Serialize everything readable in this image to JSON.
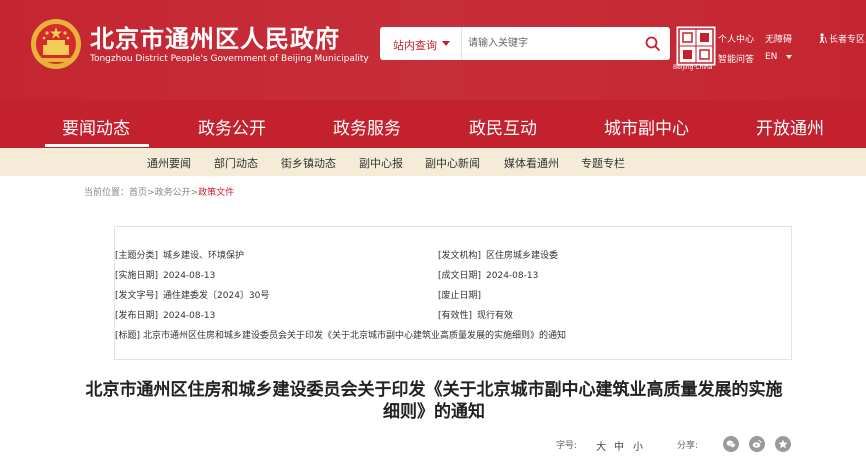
{
  "header": {
    "site_title": "北京市通州区人民政府",
    "site_subtitle": "Tongzhou District People's Government of Beijing Municipality",
    "seal_caption": "Beijing·China",
    "search": {
      "scope_label": "站内查询",
      "placeholder": "请输入关键字"
    },
    "links": {
      "personal_center": "个人中心",
      "barrier_free": "无障碍",
      "elder_version": "长者专区",
      "smart_qa": "智能问答",
      "language": "EN"
    }
  },
  "main_nav": {
    "items": [
      {
        "label": "要闻动态"
      },
      {
        "label": "政务公开"
      },
      {
        "label": "政务服务"
      },
      {
        "label": "政民互动"
      },
      {
        "label": "城市副中心"
      },
      {
        "label": "开放通州"
      }
    ]
  },
  "sub_nav": {
    "items": [
      {
        "label": "通州要闻"
      },
      {
        "label": "部门动态"
      },
      {
        "label": "街乡镇动态"
      },
      {
        "label": "副中心报"
      },
      {
        "label": "副中心新闻"
      },
      {
        "label": "媒体看通州"
      },
      {
        "label": "专题专栏"
      }
    ]
  },
  "breadcrumb": {
    "prefix": "当前位置：",
    "home": "首页",
    "sep": ">",
    "level1": "政务公开",
    "current": "政策文件"
  },
  "meta": {
    "category_key": "[主题分类]",
    "category_val": "城乡建设、环境保护",
    "issuer_key": "[发文机构]",
    "issuer_val": "区住房城乡建设委",
    "effective_key": "[实施日期]",
    "effective_val": "2024-08-13",
    "created_key": "[成文日期]",
    "created_val": "2024-08-13",
    "doc_no_key": "[发文字号]",
    "doc_no_val": "通住建委发〔2024〕30号",
    "repeal_key": "[废止日期]",
    "repeal_val": "",
    "published_key": "[发布日期]",
    "published_val": "2024-08-13",
    "validity_key": "[有效性]",
    "validity_val": "现行有效",
    "title_key": "[标题]",
    "title_val": "北京市通州区住房和城乡建设委员会关于印发《关于北京城市副中心建筑业高质量发展的实施细则》的通知"
  },
  "article": {
    "title": "北京市通州区住房和城乡建设委员会关于印发《关于北京城市副中心建筑业高质量发展的实施细则》的通知"
  },
  "tools": {
    "font_size_label": "字号:",
    "font_large": "大",
    "font_medium": "中",
    "font_small": "小",
    "share_label": "分享:",
    "share_icons": [
      "wechat-icon",
      "weibo-icon",
      "favorite-icon"
    ]
  },
  "colors": {
    "brand_red": "#c3212d",
    "subnav_bg": "#f5ebd6"
  }
}
